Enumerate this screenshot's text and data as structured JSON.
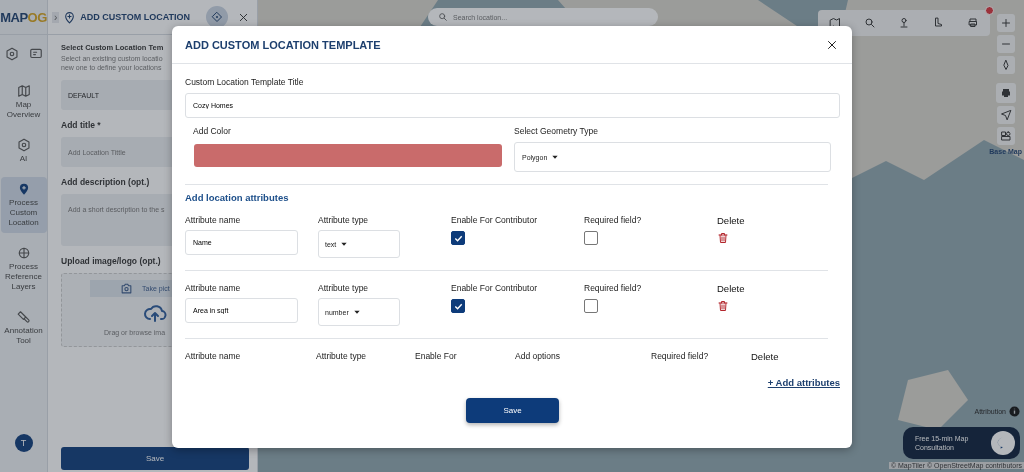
{
  "logo": "MAPOG",
  "rail": {
    "items": [
      {
        "label": "Map Overview",
        "selected": false
      },
      {
        "label": "AI",
        "selected": false
      },
      {
        "label": "Process Custom Location",
        "selected": true
      },
      {
        "label": "Process Reference Layers",
        "selected": false
      },
      {
        "label": "Annotation Tool",
        "selected": false
      }
    ],
    "avatar": "T"
  },
  "panel": {
    "toggle": "›",
    "title": "ADD CUSTOM LOCATION",
    "heading": "Select Custom Location Tem",
    "hint_lines": [
      "Select an existing custom locatio",
      "new one to define your locations"
    ],
    "template_value": "DEFAULT",
    "title_label": "Add title *",
    "title_placeholder": "Add Location Tittle",
    "desc_label": "Add description (opt.)",
    "desc_placeholder": "Add a short description to the s",
    "upload_label": "Upload image/logo (opt.)",
    "take_picture": "Take pict",
    "drag_text": "Drag or browse ima",
    "save": "Save"
  },
  "map": {
    "search_placeholder": "Search location...",
    "has_notification": true,
    "base_map_label": "Base Map",
    "attribution": "Attribution",
    "consult": "Free 15-min Map Consultation",
    "credits": "© MapTiler © OpenStreetMap contributors"
  },
  "modal": {
    "title": "ADD CUSTOM LOCATION TEMPLATE",
    "template_title_label": "Custom Location Template Title",
    "template_title_value": "Cozy Homes",
    "color_label": "Add Color",
    "color": "#c96b6b",
    "geometry_label": "Select Geometry Type",
    "geometry_value": "Polygon",
    "attributes_heading": "Add location attributes",
    "attributes": [
      {
        "kind": "basic",
        "headers": [
          "Attribute name",
          "Attribute type",
          "Enable For Contributor",
          "Required field?",
          "Delete"
        ],
        "name": "Name",
        "type": "text",
        "contributor": true,
        "required": false
      },
      {
        "kind": "basic",
        "headers": [
          "Attribute name",
          "Attribute type",
          "Enable For Contributor",
          "Required field?",
          "Delete"
        ],
        "name": "Area in sqft",
        "type": "number",
        "contributor": true,
        "required": false
      },
      {
        "kind": "options",
        "headers": [
          "Attribute name",
          "Attribute type",
          "Enable For",
          "Add options",
          "Required field?",
          "Delete"
        ]
      }
    ],
    "add_link": "+ Add attributes",
    "save": "Save"
  }
}
